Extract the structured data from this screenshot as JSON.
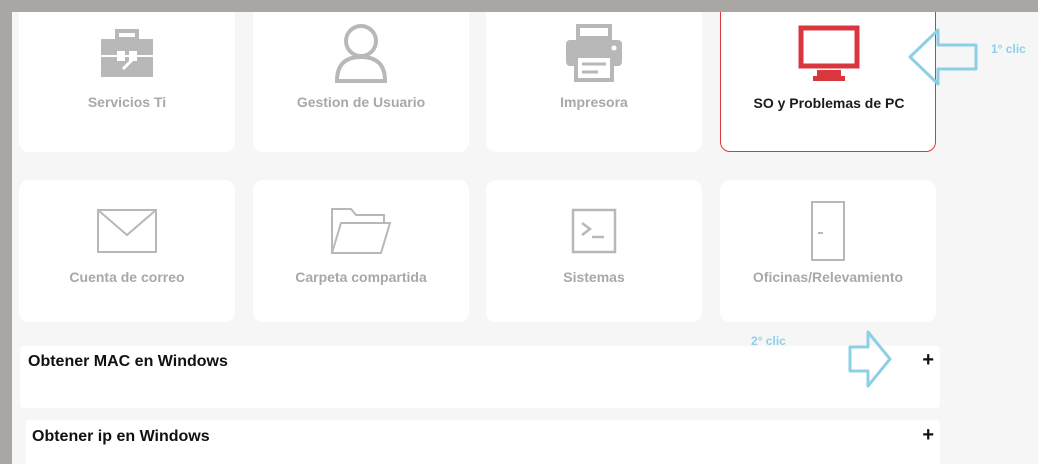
{
  "cards": [
    {
      "label": "Servicios Ti",
      "icon": "toolbox-icon",
      "selected": false
    },
    {
      "label": "Gestion de Usuario",
      "icon": "user-icon",
      "selected": false
    },
    {
      "label": "Impresora",
      "icon": "printer-icon",
      "selected": false
    },
    {
      "label": "SO y Problemas de PC",
      "icon": "monitor-icon",
      "selected": true
    },
    {
      "label": "Cuenta de correo",
      "icon": "envelope-icon",
      "selected": false
    },
    {
      "label": "Carpeta compartida",
      "icon": "folder-icon",
      "selected": false
    },
    {
      "label": "Sistemas",
      "icon": "terminal-icon",
      "selected": false
    },
    {
      "label": "Oficinas/Relevamiento",
      "icon": "door-icon",
      "selected": false
    }
  ],
  "accordion": [
    {
      "title": "Obtener MAC en Windows",
      "toggle": "+"
    },
    {
      "title": "Obtener ip en Windows",
      "toggle": "+"
    }
  ],
  "annotations": {
    "first_click": "1° clic",
    "second_click": "2° clic"
  },
  "colors": {
    "accent": "#d9373d",
    "icon_gray": "#b8b8b8",
    "arrow": "#8dd0e6"
  }
}
